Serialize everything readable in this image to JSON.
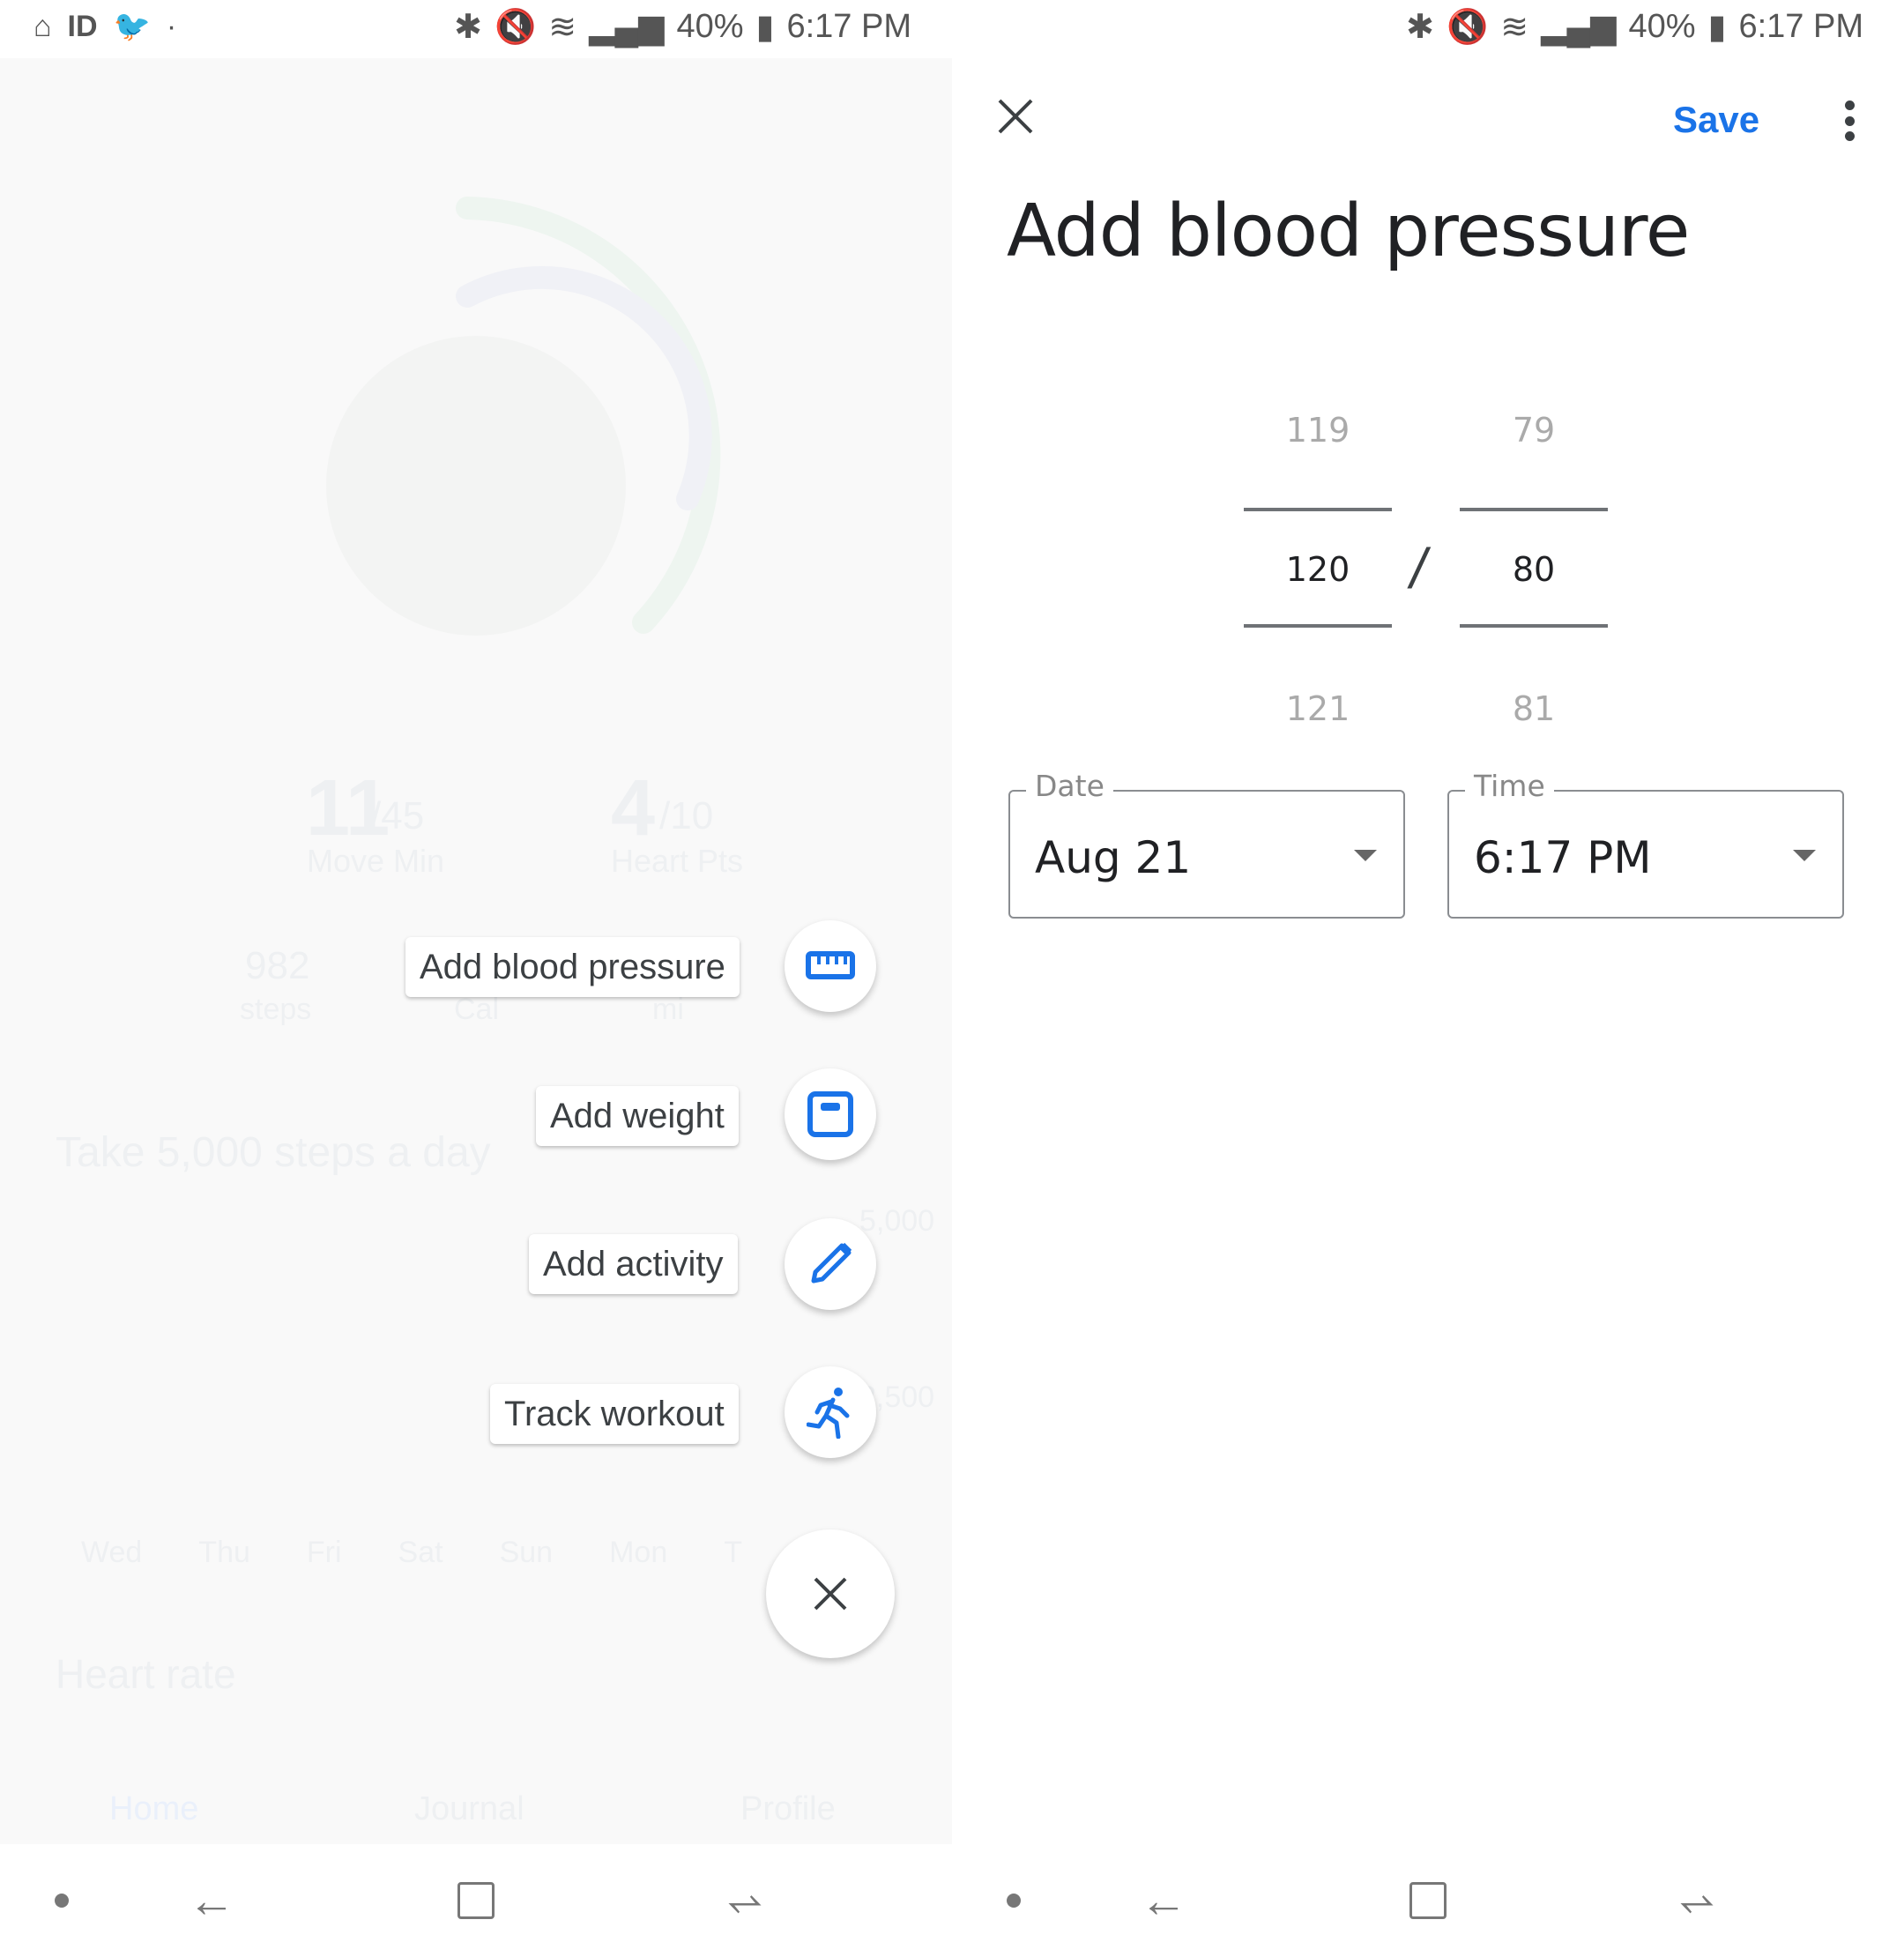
{
  "status_bar": {
    "battery": "40%",
    "time": "6:17 PM",
    "left_icons": [
      "home-icon",
      "id-icon",
      "twitter-icon",
      "dot-icon"
    ],
    "right_icons": [
      "bluetooth-icon",
      "vibrate-icon",
      "wifi-icon",
      "signal-icon",
      "battery-icon"
    ]
  },
  "background_home": {
    "move_min": "11",
    "move_min_goal": "/45",
    "move_min_label": "Move Min",
    "heart_pts": "4",
    "heart_pts_goal": "/10",
    "heart_pts_label": "Heart Pts",
    "steps": "982",
    "steps_label": "steps",
    "cal_label": "Cal",
    "mi_label": "mi",
    "goal_title": "Take 5,000 steps a day",
    "axis": [
      "5,000",
      "2,500"
    ],
    "days": [
      "Wed",
      "Thu",
      "Fri",
      "Sat",
      "Sun",
      "Mon",
      "T"
    ],
    "heart_rate_title": "Heart rate",
    "tabs": [
      "Home",
      "Journal",
      "Profile"
    ]
  },
  "fab_menu": {
    "items": [
      {
        "label": "Add blood pressure",
        "icon": "blood-pressure-icon"
      },
      {
        "label": "Add weight",
        "icon": "scale-icon"
      },
      {
        "label": "Add activity",
        "icon": "pencil-icon"
      },
      {
        "label": "Track workout",
        "icon": "run-icon"
      }
    ],
    "close_icon": "close-icon",
    "accent": "#1a73e8"
  },
  "dialog": {
    "save_label": "Save",
    "title": "Add blood pressure",
    "systolic": {
      "prev": "119",
      "value": "120",
      "next": "121"
    },
    "separator": "/",
    "diastolic": {
      "prev": "79",
      "value": "80",
      "next": "81"
    },
    "date": {
      "label": "Date",
      "value": "Aug 21"
    },
    "time": {
      "label": "Time",
      "value": "6:17 PM"
    }
  }
}
